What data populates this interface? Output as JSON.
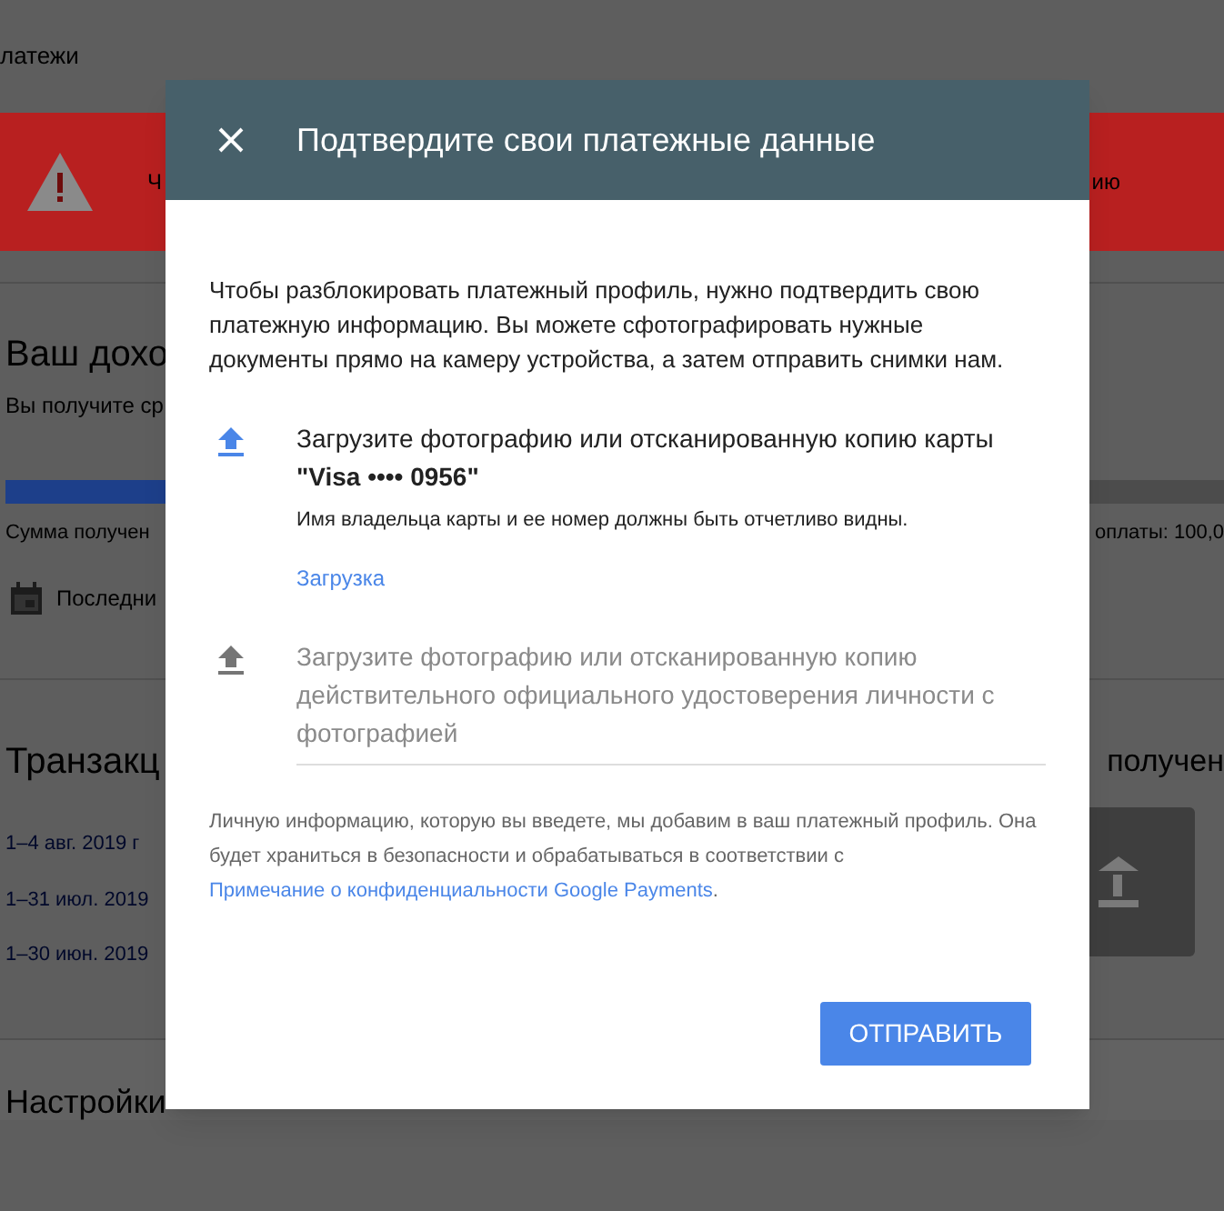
{
  "page": {
    "breadcrumb": "латежи",
    "banner": {
      "text_left": "Ч",
      "text_right": "ию"
    },
    "earnings": {
      "title": "Ваш дохо",
      "subtitle": "Вы получите ср",
      "level": 0.3,
      "bar_caption": "Сумма получен",
      "bar_caption_right": "оплаты: 100,0",
      "period": "Последни"
    },
    "transactions": {
      "title": "Транзакц",
      "right_title": "получен",
      "links": [
        "1–4 авг. 2019 г",
        "1–31 июл. 2019",
        "1–30 июн. 2019"
      ]
    },
    "settings_title": "Настройки"
  },
  "dialog": {
    "title": "Подтвердите свои платежные данные",
    "intro": "Чтобы разблокировать платежный профиль, нужно подтвердить свою платежную информацию. Вы можете сфотографировать нужные документы прямо на камеру устройства, а затем отправить снимки нам.",
    "steps": [
      {
        "title": "Загрузите фотографию или отсканированную копию карты **\"Visa •••• 0956\"**",
        "hint": "Имя владельца карты и ее номер должны быть отчетливо видны.",
        "link": "Загрузка",
        "disabled": false
      },
      {
        "title": "Загрузите фотографию или отсканированную копию действительного официального удостоверения личности с фотографией",
        "disabled": true
      }
    ],
    "footer_text": "Личную информацию, которую вы введете, мы добавим в ваш платежный профиль. Она будет храниться в безопасности и обрабатываться в соответствии с",
    "footer_link": "Примечание о конфиденциальности Google Payments",
    "footer_end": ".",
    "submit": "ОТПРАВИТЬ"
  }
}
